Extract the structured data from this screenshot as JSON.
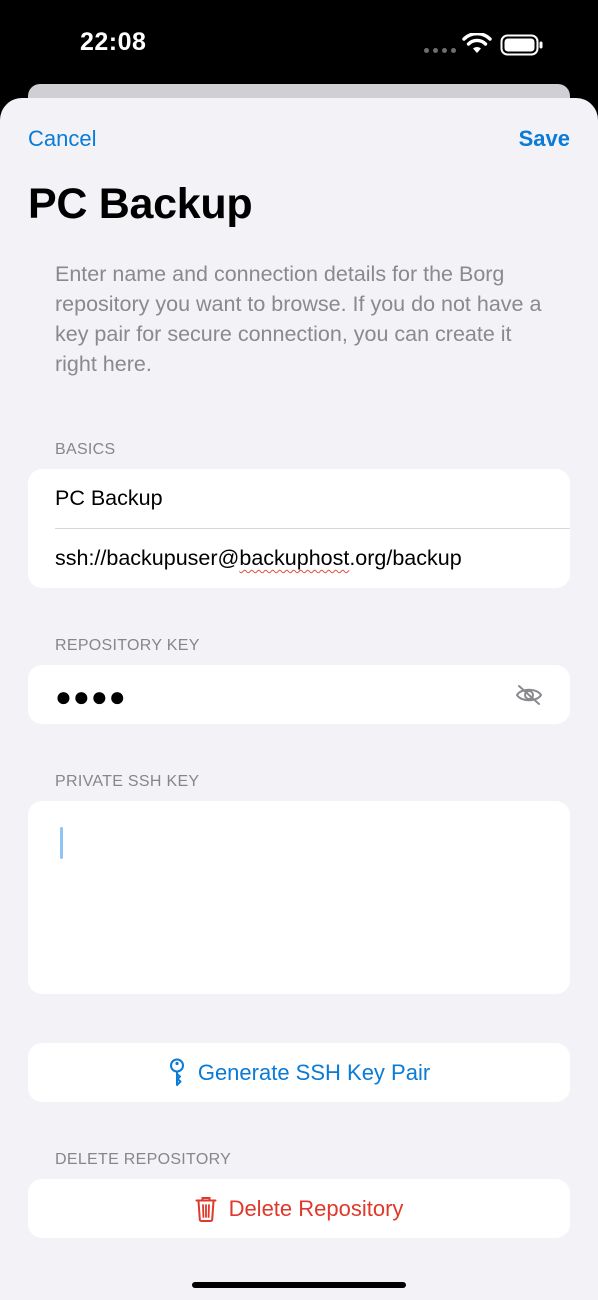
{
  "status_bar": {
    "time": "22:08",
    "icons": [
      "cellular-dots-icon",
      "wifi-icon",
      "battery-icon"
    ]
  },
  "nav": {
    "cancel_label": "Cancel",
    "save_label": "Save"
  },
  "title": "PC Backup",
  "description": "Enter name and connection details for the Borg repository you want to browse. If you do not have a key pair for secure connection, you can create it right here.",
  "sections": {
    "basics": {
      "header": "BASICS",
      "name_value": "PC Backup",
      "url_prefix": "ssh://backupuser@",
      "url_underlined": "backuphost",
      "url_suffix": ".org/backup"
    },
    "repository_key": {
      "header": "REPOSITORY KEY",
      "masked_value": "●●●●",
      "visibility_icon": "eye-slash-icon"
    },
    "private_ssh_key": {
      "header": "PRIVATE SSH KEY",
      "value": ""
    },
    "generate": {
      "label": "Generate SSH Key Pair",
      "icon": "key-icon"
    },
    "delete": {
      "header": "DELETE REPOSITORY",
      "label": "Delete Repository",
      "icon": "trash-icon"
    }
  },
  "colors": {
    "accent": "#0a7bd6",
    "destructive": "#e0382b",
    "background": "#f2f2f7",
    "secondary_text": "#8a8a8e"
  }
}
